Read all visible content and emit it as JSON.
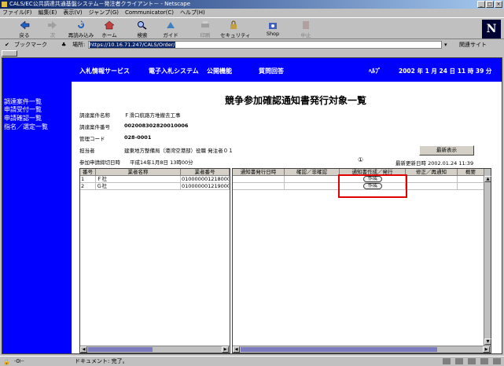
{
  "window": {
    "title": "CALS/EC公共調達共通基盤システム－発注者クライアント－ - Netscape",
    "controls": {
      "minimize": "_",
      "maximize": "□",
      "close": "×"
    }
  },
  "menu": [
    "ファイル(F)",
    "編集(E)",
    "表示(V)",
    "ジャンプ(G)",
    "Communicator(C)",
    "ヘルプ(H)"
  ],
  "toolbar": {
    "back": "戻る",
    "forward": "次",
    "reload": "再読み込み",
    "home": "ホーム",
    "search": "検索",
    "guide": "ガイド",
    "print": "印刷",
    "security": "セキュリティ",
    "shop": "Shop",
    "stop": "中止",
    "logo": "N"
  },
  "location": {
    "bookmark": "ブックマーク",
    "label": "場所:",
    "url": "https://10.16.71.247/CALS/Order/",
    "related": "関連サイト"
  },
  "sidebar": [
    "調達案件一覧",
    "申請受付一覧",
    "申請確認一覧",
    "指名／選定一覧"
  ],
  "nav": {
    "items": [
      "入札情報サービス",
      "電子入札システム",
      "公開機能",
      "質問回答"
    ],
    "help": "ﾍﾙﾌﾟ",
    "date": "2002 年  1 月 24 日  11 時 39 分"
  },
  "page_title": "競争参加確認通知書発行対象一覧",
  "info": {
    "case_name_label": "調達案件名称",
    "case_name": "Ｆ滑口航路方堆撤去工事",
    "case_no_label": "調達案件番号",
    "case_no": "002008302820010006",
    "mgmt_code_label": "管理コード",
    "mgmt_code": "028-0001",
    "person_label": "担当者",
    "person": "建東地方整備局（港湾空港部）役職 発注者０１",
    "deadline_label": "参加申請締切日時",
    "deadline": "平成14年1月8日 13時00分"
  },
  "refresh_button": "最新表示",
  "marker": "①",
  "last_update": "最新更新日時 2002.01.24 11:39",
  "left_table": {
    "headers": [
      "番号",
      "業者名称",
      "業者番号"
    ],
    "rows": [
      {
        "no": "1",
        "name": "Ｆ社",
        "code": "010000001218000"
      },
      {
        "no": "2",
        "name": "Ｇ社",
        "code": "010000001219000"
      }
    ]
  },
  "right_table": {
    "headers": [
      "通知書発行日時",
      "確認／非確認",
      "通知書作成／発行",
      "修正／再通知",
      "概要"
    ],
    "rows": [
      {
        "action": "作成"
      },
      {
        "action": "作成"
      }
    ]
  },
  "status": "ドキュメント: 完了。"
}
